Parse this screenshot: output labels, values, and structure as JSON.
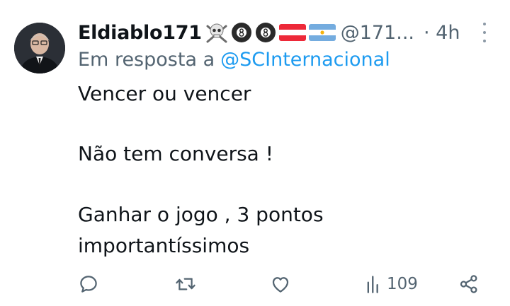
{
  "author": {
    "display_name": "Eldiablo171",
    "handle": "@171...",
    "time": "· 4h",
    "emoji_icons": [
      "skull-crossbones-icon",
      "billiard-8-ball-icon",
      "billiard-8-ball-icon",
      "austria-flag-icon",
      "argentina-flag-icon"
    ]
  },
  "reply": {
    "prefix": "Em resposta a",
    "mention": "@SCInternacional"
  },
  "body": {
    "lines": [
      "Vencer ou vencer",
      "Não tem conversa !",
      "Ganhar o jogo , 3 pontos",
      "importantíssimos"
    ]
  },
  "actions": {
    "reply_icon": "speech-bubble-icon",
    "retweet_icon": "retweet-icon",
    "like_icon": "heart-icon",
    "views_icon": "bar-chart-icon",
    "views_count": "109",
    "share_icon": "share-icon"
  },
  "colors": {
    "text": "#0f1419",
    "secondary": "#536471",
    "link": "#1d9bf0",
    "icon": "#536471"
  }
}
